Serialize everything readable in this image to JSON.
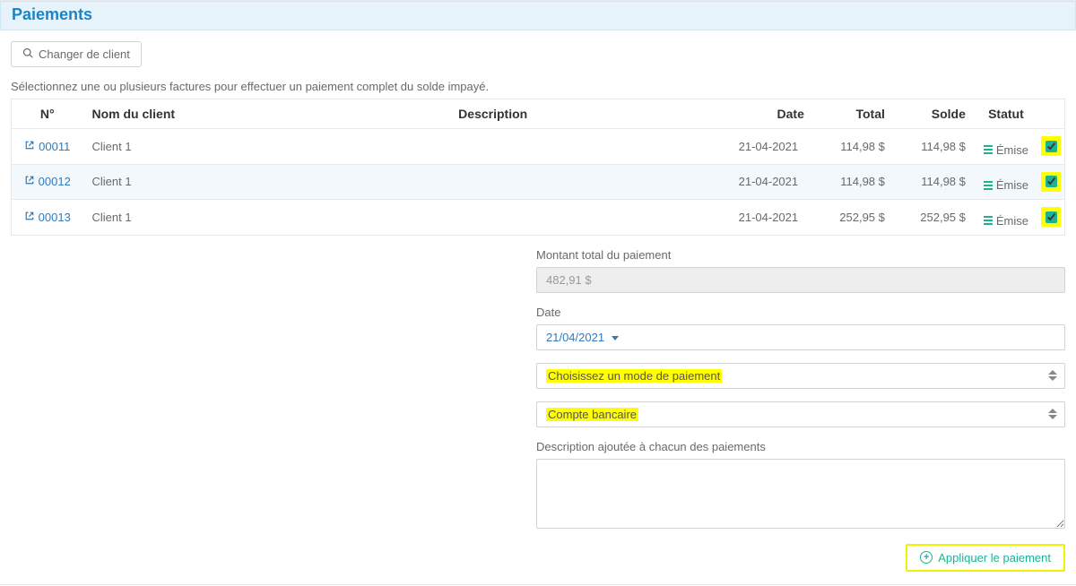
{
  "header": {
    "title": "Paiements"
  },
  "toolbar": {
    "change_client_label": "Changer de client"
  },
  "instructions": "Sélectionnez une ou plusieurs factures pour effectuer un paiement complet du solde impayé.",
  "table": {
    "headers": {
      "num": "N°",
      "client": "Nom du client",
      "description": "Description",
      "date": "Date",
      "total": "Total",
      "balance": "Solde",
      "status": "Statut"
    },
    "rows": [
      {
        "num": "00011",
        "client": "Client 1",
        "description": "",
        "date": "21-04-2021",
        "total": "114,98 $",
        "balance": "114,98 $",
        "status": "Émise",
        "checked": true
      },
      {
        "num": "00012",
        "client": "Client 1",
        "description": "",
        "date": "21-04-2021",
        "total": "114,98 $",
        "balance": "114,98 $",
        "status": "Émise",
        "checked": true
      },
      {
        "num": "00013",
        "client": "Client 1",
        "description": "",
        "date": "21-04-2021",
        "total": "252,95 $",
        "balance": "252,95 $",
        "status": "Émise",
        "checked": true
      }
    ]
  },
  "form": {
    "total_label": "Montant total du paiement",
    "total_value": "482,91 $",
    "date_label": "Date",
    "date_value": "21/04/2021",
    "method_placeholder": "Choisissez un mode de paiement",
    "account_placeholder": "Compte bancaire",
    "desc_label": "Description ajoutée à chacun des paiements"
  },
  "actions": {
    "apply_label": "Appliquer le paiement"
  },
  "icons": {
    "search": "search-icon",
    "open": "external-link-icon",
    "plus": "plus-circle-icon"
  },
  "colors": {
    "accent_blue": "#1c84c6",
    "link_blue": "#337ab7",
    "success_green": "#1ab394",
    "highlight_yellow": "#ffff00"
  }
}
